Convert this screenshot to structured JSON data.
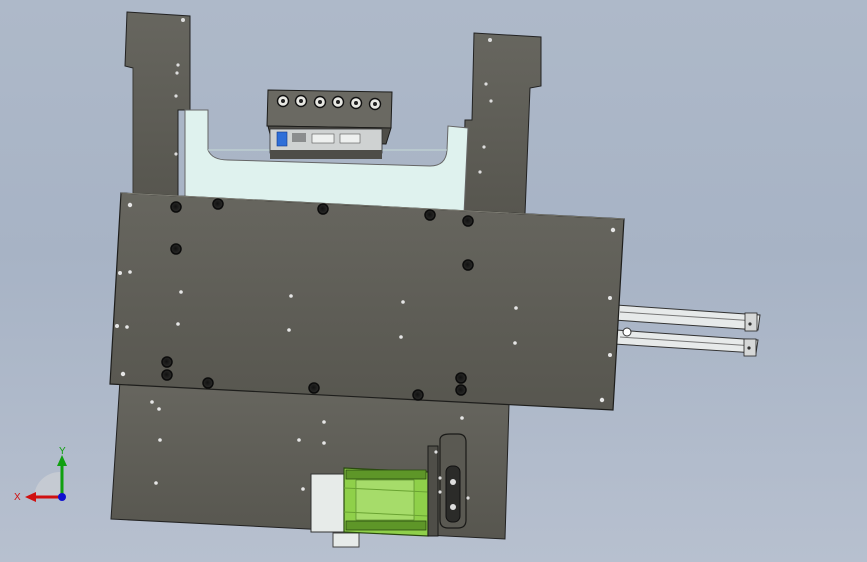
{
  "window": {
    "title": ""
  },
  "triad": {
    "x_label": "X",
    "y_label": "Y",
    "x_color": "#d01010",
    "y_color": "#10a010",
    "z_color": "#1010d0"
  },
  "colors": {
    "background_top": "#aeb9c9",
    "background_bottom": "#b7c0cf",
    "plate": "#5e5d56",
    "plate_edge": "#2a2a28",
    "coolant_block": "#dff2ee",
    "motor_green": "#8fd04a",
    "motor_dark": "#3f6a1d",
    "sensor_blue": "#2f6fd8"
  }
}
